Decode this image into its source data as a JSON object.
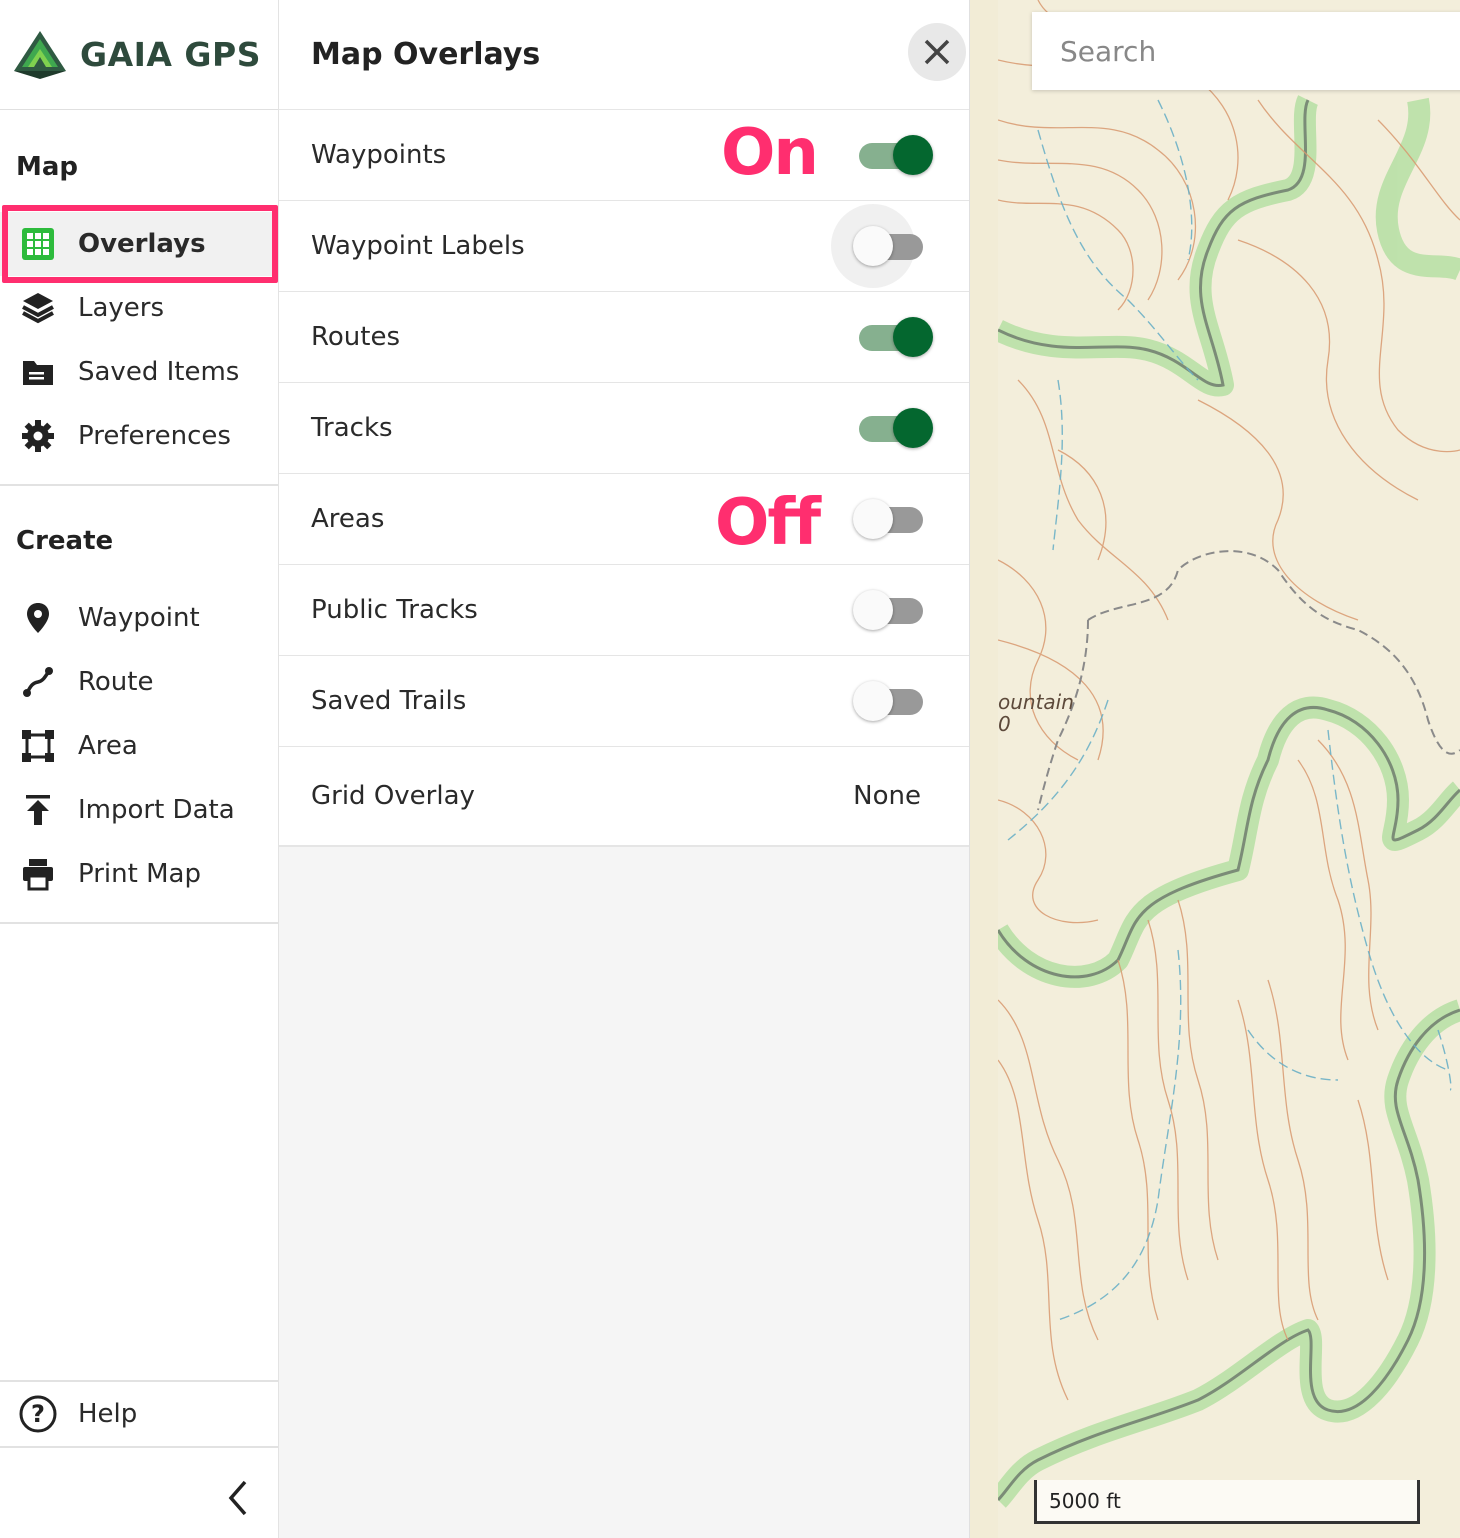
{
  "brand": {
    "name": "GAIA GPS"
  },
  "sidebar": {
    "map_section": "Map",
    "map_items": [
      {
        "label": "Overlays",
        "icon": "grid-icon",
        "active": true
      },
      {
        "label": "Layers",
        "icon": "layers-icon"
      },
      {
        "label": "Saved Items",
        "icon": "folder-icon"
      },
      {
        "label": "Preferences",
        "icon": "gear-icon"
      }
    ],
    "create_section": "Create",
    "create_items": [
      {
        "label": "Waypoint",
        "icon": "pin-icon"
      },
      {
        "label": "Route",
        "icon": "route-icon"
      },
      {
        "label": "Area",
        "icon": "area-icon"
      },
      {
        "label": "Import Data",
        "icon": "upload-icon"
      },
      {
        "label": "Print Map",
        "icon": "printer-icon"
      }
    ],
    "help": {
      "label": "Help",
      "icon": "help-icon"
    },
    "collapse_icon": "chevron-left-icon"
  },
  "panel": {
    "title": "Map Overlays",
    "rows": [
      {
        "label": "Waypoints",
        "on": true
      },
      {
        "label": "Waypoint Labels",
        "on": false
      },
      {
        "label": "Routes",
        "on": true
      },
      {
        "label": "Tracks",
        "on": true
      },
      {
        "label": "Areas",
        "on": false
      },
      {
        "label": "Public Tracks",
        "on": false
      },
      {
        "label": "Saved Trails",
        "on": false
      }
    ],
    "grid_overlay": {
      "label": "Grid Overlay",
      "value": "None"
    }
  },
  "annotations": {
    "on": "On",
    "off": "Off"
  },
  "map": {
    "search_placeholder": "Search",
    "place_label_line1": "ountain",
    "place_label_line2": "0",
    "scale": "5000 ft"
  },
  "colors": {
    "accent": "#ff2e6f",
    "toggle_on": "#04672f",
    "toggle_on_track": "#86b08f",
    "toggle_off_track": "#999999",
    "brand_green": "#2e4a3c"
  }
}
